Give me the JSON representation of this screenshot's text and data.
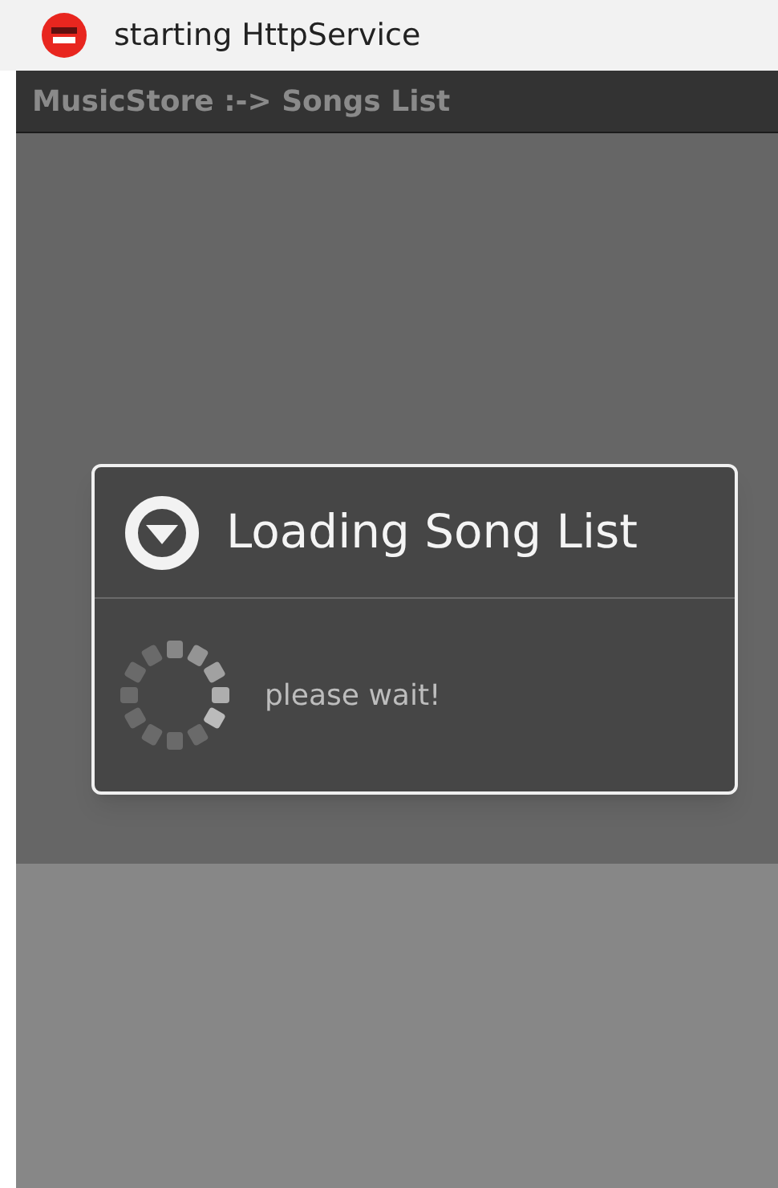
{
  "notification": {
    "text": "starting HttpService"
  },
  "title_bar": {
    "title": "MusicStore :-> Songs List"
  },
  "dialog": {
    "title": "Loading Song List",
    "message": "please wait!"
  }
}
